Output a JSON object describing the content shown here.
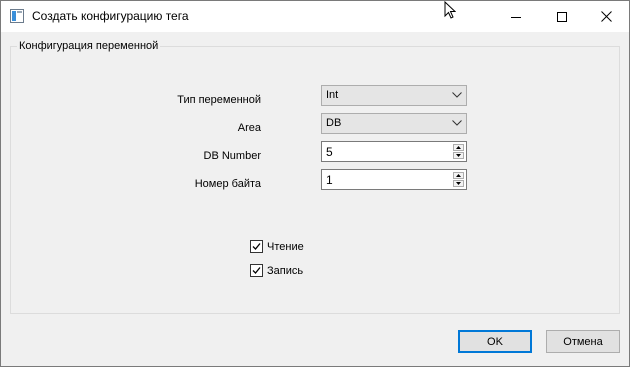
{
  "window": {
    "title": "Создать конфигурацию тега",
    "icon": "app-window-icon"
  },
  "group": {
    "title": "Конфигурация переменной"
  },
  "fields": {
    "var_type": {
      "label": "Тип переменной",
      "value": "Int"
    },
    "area": {
      "label": "Area",
      "value": "DB"
    },
    "db_number": {
      "label": "DB Number",
      "value": "5"
    },
    "byte_number": {
      "label": "Номер байта",
      "value": "1"
    }
  },
  "checkboxes": {
    "read": {
      "label": "Чтение",
      "checked": true
    },
    "write": {
      "label": "Запись",
      "checked": true
    }
  },
  "buttons": {
    "ok": "OK",
    "cancel": "Отмена"
  },
  "colors": {
    "accent": "#0078d7",
    "window_bg": "#f0f0f0",
    "titlebar_bg": "#ffffff"
  }
}
